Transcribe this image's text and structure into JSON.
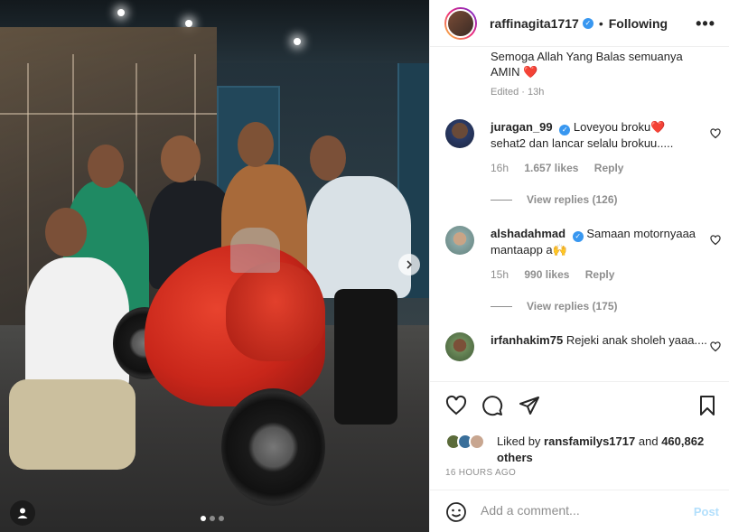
{
  "photo": {
    "carousel_dots": 3,
    "active_dot": 0
  },
  "header": {
    "username": "raffinagita1717",
    "separator": "•",
    "follow_label": "Following",
    "more_label": "•••"
  },
  "caption": {
    "text": "Semoga Allah Yang Balas semuanya AMIN",
    "emoji": "❤️",
    "edited": "Edited · 13h"
  },
  "comments": [
    {
      "username": "juragan_99",
      "text": "Loveyou broku",
      "emoji": "❤️",
      "text2": "sehat2 dan lancar selalu brokuu.....",
      "time": "16h",
      "likes": "1.657 likes",
      "reply": "Reply",
      "view_replies": "View replies (126)"
    },
    {
      "username": "alshadahmad",
      "text": "Samaan motornyaaa mantaapp a",
      "emoji": "🙌",
      "time": "15h",
      "likes": "990 likes",
      "reply": "Reply",
      "view_replies": "View replies (175)"
    },
    {
      "username": "irfanhakim75",
      "text": "Rejeki anak sholeh yaaa....",
      "time": "",
      "likes": "",
      "reply": ""
    }
  ],
  "likes": {
    "prefix": "Liked by",
    "user": "ransfamilys1717",
    "and": "and",
    "count": "460,862",
    "others": "others"
  },
  "timestamp": "16 HOURS AGO",
  "add_comment": {
    "placeholder": "Add a comment...",
    "post_label": "Post"
  },
  "colors": {
    "verified": "#3897f0",
    "post_disabled": "#b2dffc",
    "muted": "#8e8e8e"
  }
}
